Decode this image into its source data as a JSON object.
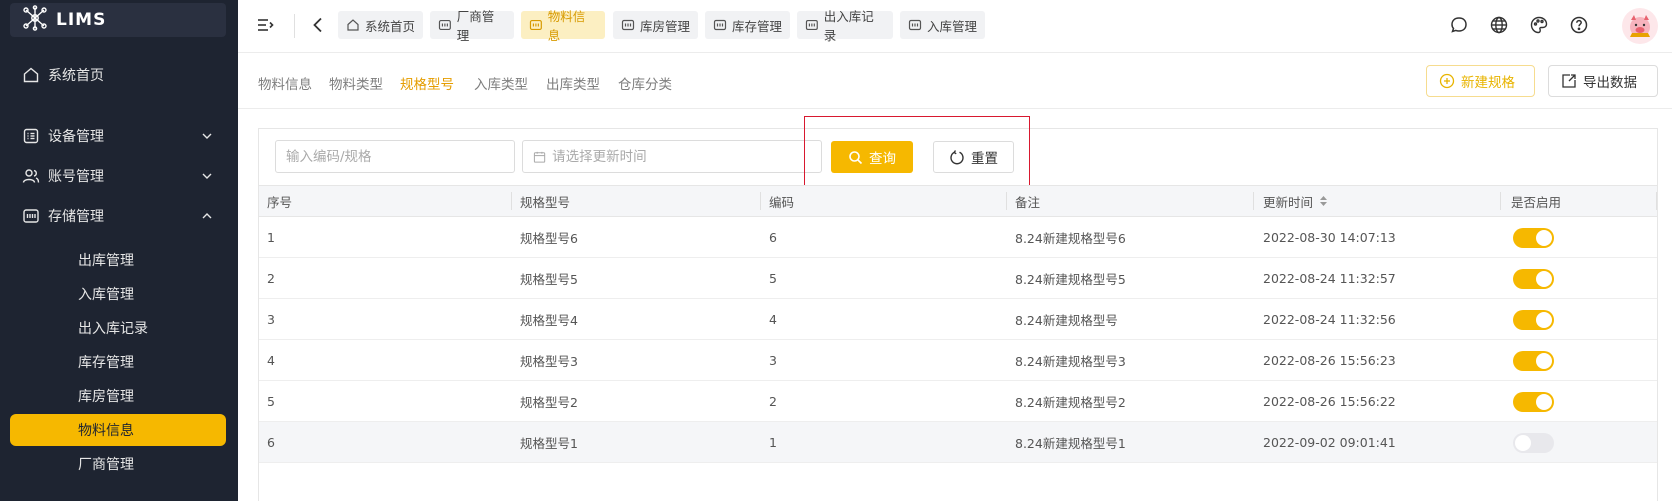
{
  "app": {
    "name": "LIMS"
  },
  "sidebar": {
    "home": "系统首页",
    "groups": [
      {
        "label": "设备管理",
        "expanded": false
      },
      {
        "label": "账号管理",
        "expanded": false
      },
      {
        "label": "存储管理",
        "expanded": true
      }
    ],
    "storage_items": [
      {
        "label": "出库管理"
      },
      {
        "label": "入库管理"
      },
      {
        "label": "出入库记录"
      },
      {
        "label": "库存管理"
      },
      {
        "label": "库房管理"
      },
      {
        "label": "物料信息",
        "active": true
      },
      {
        "label": "厂商管理"
      }
    ]
  },
  "topbar": {
    "tabs": [
      {
        "label": "系统首页",
        "icon": "home-icon"
      },
      {
        "label": "厂商管理",
        "icon": "storage-icon"
      },
      {
        "label": "物料信息",
        "icon": "storage-icon",
        "active": true
      },
      {
        "label": "库房管理",
        "icon": "storage-icon"
      },
      {
        "label": "库存管理",
        "icon": "storage-icon"
      },
      {
        "label": "出入库记录",
        "icon": "storage-icon"
      },
      {
        "label": "入库管理",
        "icon": "storage-icon"
      }
    ]
  },
  "subnav": {
    "tabs": [
      {
        "label": "物料信息"
      },
      {
        "label": "物料类型"
      },
      {
        "label": "规格型号",
        "active": true
      },
      {
        "label": "入库类型"
      },
      {
        "label": "出库类型"
      },
      {
        "label": "仓库分类"
      }
    ],
    "new_button": "新建规格",
    "export_button": "导出数据"
  },
  "filters": {
    "code_placeholder": "输入编码/规格",
    "date_placeholder": "请选择更新时间",
    "search_button": "查询",
    "reset_button": "重置"
  },
  "table": {
    "headers": [
      "序号",
      "规格型号",
      "编码",
      "备注",
      "更新时间",
      "是否启用"
    ],
    "rows": [
      {
        "index": "1",
        "model": "规格型号6",
        "code": "6",
        "remark": "8.24新建规格型号6",
        "updated": "2022-08-30 14:07:13",
        "enabled": true
      },
      {
        "index": "2",
        "model": "规格型号5",
        "code": "5",
        "remark": "8.24新建规格型号5",
        "updated": "2022-08-24 11:32:57",
        "enabled": true
      },
      {
        "index": "3",
        "model": "规格型号4",
        "code": "4",
        "remark": "8.24新建规格型号",
        "updated": "2022-08-24 11:32:56",
        "enabled": true
      },
      {
        "index": "4",
        "model": "规格型号3",
        "code": "3",
        "remark": "8.24新建规格型号3",
        "updated": "2022-08-26 15:56:23",
        "enabled": true
      },
      {
        "index": "5",
        "model": "规格型号2",
        "code": "2",
        "remark": "8.24新建规格型号2",
        "updated": "2022-08-26 15:56:22",
        "enabled": true
      },
      {
        "index": "6",
        "model": "规格型号1",
        "code": "1",
        "remark": "8.24新建规格型号1",
        "updated": "2022-09-02 09:01:41",
        "enabled": false
      }
    ]
  },
  "colors": {
    "accent": "#f6b800",
    "sidebar_bg": "#1e2431",
    "highlight_box": "#d8182f"
  }
}
